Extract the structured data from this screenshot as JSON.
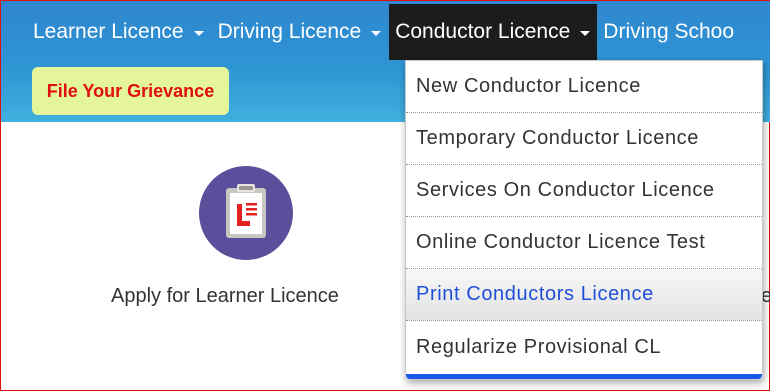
{
  "nav": {
    "items": [
      {
        "label": "Learner Licence"
      },
      {
        "label": "Driving Licence"
      },
      {
        "label": "Conductor Licence"
      },
      {
        "label": "Driving Schoo"
      }
    ]
  },
  "grievance_button": {
    "label": "File Your Grievance"
  },
  "cards": [
    {
      "label": "Apply for Learner Licence",
      "icon": "clipboard-l-icon"
    }
  ],
  "edge_text": "e",
  "dropdown": {
    "items": [
      {
        "label": "New Conductor Licence"
      },
      {
        "label": "Temporary Conductor Licence"
      },
      {
        "label": "Services On Conductor Licence"
      },
      {
        "label": "Online Conductor Licence Test"
      },
      {
        "label": "Print Conductors Licence"
      },
      {
        "label": "Regularize Provisional CL"
      }
    ]
  },
  "colors": {
    "header": "#2e95d3",
    "active_tab": "#1c1c1c",
    "grievance_bg": "#e4f59a",
    "grievance_text": "#e01010",
    "icon_circle": "#5a4f9a",
    "hover_link": "#1f4fd8",
    "dropdown_accent": "#1a57e6"
  }
}
